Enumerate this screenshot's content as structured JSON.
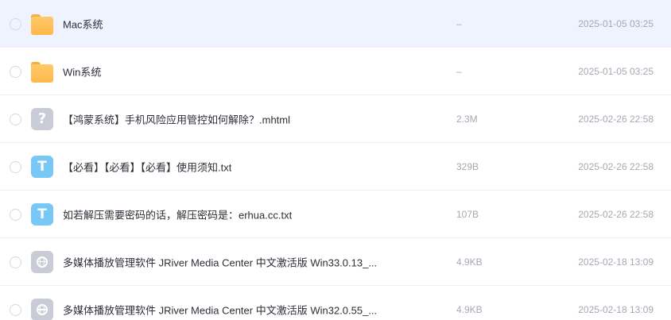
{
  "files": [
    {
      "name": "Mac系统",
      "size": "–",
      "date": "2025-01-05 03:25",
      "icon": "folder-icon",
      "selected": true
    },
    {
      "name": "Win系统",
      "size": "–",
      "date": "2025-01-05 03:25",
      "icon": "folder-icon",
      "selected": false
    },
    {
      "name": "【鸿蒙系统】手机风险应用管控如何解除？.mhtml",
      "size": "2.3M",
      "date": "2025-02-26 22:58",
      "icon": "unknown-file-icon",
      "selected": false
    },
    {
      "name": "【必看】【必看】【必看】使用须知.txt",
      "size": "329B",
      "date": "2025-02-26 22:58",
      "icon": "text-file-icon",
      "selected": false
    },
    {
      "name": "如若解压需要密码的话，解压密码是：erhua.cc.txt",
      "size": "107B",
      "date": "2025-02-26 22:58",
      "icon": "text-file-icon",
      "selected": false
    },
    {
      "name": "多媒体播放管理软件 JRiver Media Center 中文激活版 Win33.0.13_...",
      "size": "4.9KB",
      "date": "2025-02-18 13:09",
      "icon": "web-file-icon",
      "selected": false
    },
    {
      "name": "多媒体播放管理软件 JRiver Media Center 中文激活版 Win32.0.55_...",
      "size": "4.9KB",
      "date": "2025-02-18 13:09",
      "icon": "web-file-icon",
      "selected": false
    }
  ],
  "icon_glyphs": {
    "unknown": "?",
    "text": "T"
  },
  "colors": {
    "selected_row": "#eef3ff",
    "folder": "#ffb84a",
    "txt_icon": "#78c8f5",
    "grey_icon": "#c9ccd6",
    "meta_text": "#a4a9b3",
    "name_text": "#2b2f36"
  }
}
